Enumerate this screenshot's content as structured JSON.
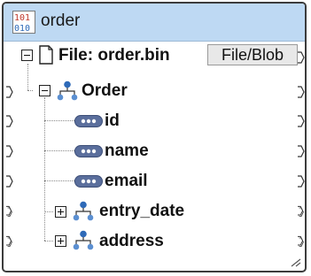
{
  "component": {
    "title": "order",
    "title_icon": "binary-file-icon"
  },
  "tree": {
    "file_label": "File: order.bin",
    "file_button": "File/Blob",
    "root": {
      "label": "Order",
      "expanded": true
    },
    "items": [
      {
        "label": "id",
        "kind": "attribute"
      },
      {
        "label": "name",
        "kind": "attribute"
      },
      {
        "label": "email",
        "kind": "attribute"
      },
      {
        "label": "entry_date",
        "kind": "element",
        "expanded": false
      },
      {
        "label": "address",
        "kind": "element",
        "expanded": false
      }
    ]
  },
  "colors": {
    "title_bar": "#bed9f3",
    "node_icon": "#2e6ab8",
    "attribute_icon": "#5a6e9c"
  }
}
